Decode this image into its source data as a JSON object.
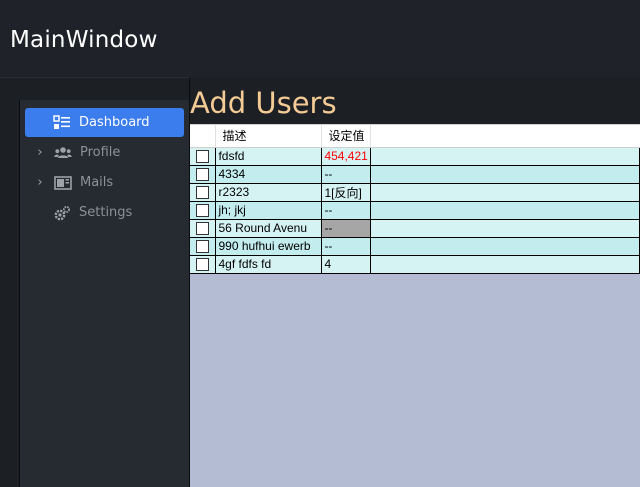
{
  "window": {
    "title": "MainWindow"
  },
  "sidebar": {
    "items": [
      {
        "label": "Dashboard",
        "icon": "dashboard-icon",
        "active": true,
        "expandable": false
      },
      {
        "label": "Profile",
        "icon": "users-icon",
        "active": false,
        "expandable": true
      },
      {
        "label": "Mails",
        "icon": "mail-icon",
        "active": false,
        "expandable": true
      },
      {
        "label": "Settings",
        "icon": "gear-icon",
        "active": false,
        "expandable": false
      }
    ]
  },
  "main": {
    "title": "Add Users",
    "table": {
      "columns": [
        "描述",
        "设定值"
      ],
      "rows": [
        {
          "desc": "fdsfd",
          "value": "454,421",
          "value_style": "red"
        },
        {
          "desc": "4334",
          "value": "--",
          "value_style": "normal"
        },
        {
          "desc": "r2323",
          "value": "1[反向]",
          "value_style": "normal"
        },
        {
          "desc": "jh; jkj",
          "value": "--",
          "value_style": "normal"
        },
        {
          "desc": "56 Round Avenu",
          "value": "--",
          "value_style": "gray"
        },
        {
          "desc": "990 hufhui ewerb",
          "value": "--",
          "value_style": "normal"
        },
        {
          "desc": "4gf fdfs fd",
          "value": "4",
          "value_style": "normal"
        }
      ]
    }
  },
  "colors": {
    "accent": "#3b7ded",
    "title": "#f4cb94",
    "row_a": "#d6f3f3",
    "row_b": "#c2ecee",
    "table_bg": "#b4bcd3",
    "error_text": "#ff0000"
  }
}
